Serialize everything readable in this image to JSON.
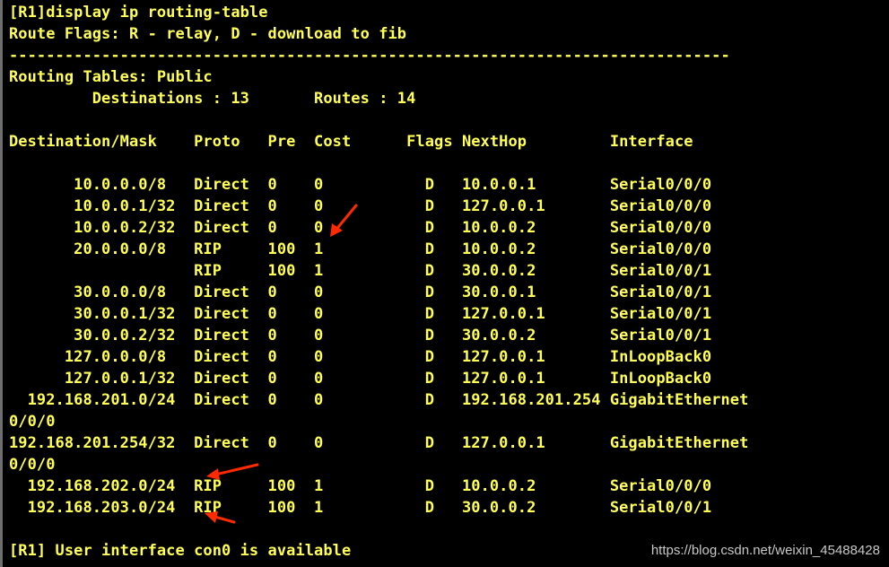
{
  "terminal": {
    "lines": [
      "[R1]display ip routing-table",
      "Route Flags: R - relay, D - download to fib",
      "------------------------------------------------------------------------------",
      "Routing Tables: Public",
      "         Destinations : 13       Routes : 14",
      "",
      "Destination/Mask    Proto   Pre  Cost      Flags NextHop         Interface",
      "",
      "       10.0.0.0/8   Direct  0    0           D   10.0.0.1        Serial0/0/0",
      "       10.0.0.1/32  Direct  0    0           D   127.0.0.1       Serial0/0/0",
      "       10.0.0.2/32  Direct  0    0           D   10.0.0.2        Serial0/0/0",
      "       20.0.0.0/8   RIP     100  1           D   10.0.0.2        Serial0/0/0",
      "                    RIP     100  1           D   30.0.0.2        Serial0/0/1",
      "       30.0.0.0/8   Direct  0    0           D   30.0.0.1        Serial0/0/1",
      "       30.0.0.1/32  Direct  0    0           D   127.0.0.1       Serial0/0/1",
      "       30.0.0.2/32  Direct  0    0           D   30.0.0.2        Serial0/0/1",
      "      127.0.0.0/8   Direct  0    0           D   127.0.0.1       InLoopBack0",
      "      127.0.0.1/32  Direct  0    0           D   127.0.0.1       InLoopBack0",
      "  192.168.201.0/24  Direct  0    0           D   192.168.201.254 GigabitEthernet",
      "0/0/0",
      "192.168.201.254/32  Direct  0    0           D   127.0.0.1       GigabitEthernet",
      "0/0/0",
      "  192.168.202.0/24  RIP     100  1           D   10.0.0.2        Serial0/0/0",
      "  192.168.203.0/24  RIP     100  1           D   30.0.0.2        Serial0/0/1",
      "",
      "[R1] User interface con0 is available"
    ]
  },
  "watermark": "https://blog.csdn.net/weixin_45488428",
  "colors": {
    "background": "#000000",
    "text": "#ffff55",
    "arrow": "#ff2a00",
    "watermark": "#c8c8c8"
  }
}
